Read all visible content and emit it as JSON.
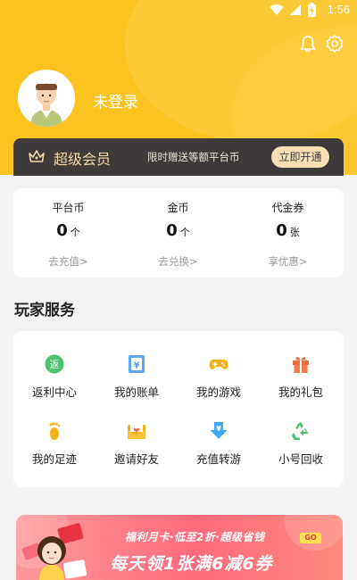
{
  "status_bar": {
    "time": "1:56"
  },
  "header": {
    "login_text": "未登录"
  },
  "vip": {
    "title": "超级会员",
    "promo": "限时赠送等额平台币",
    "button": "立即开通"
  },
  "wallet": [
    {
      "label": "平台币",
      "value": "0",
      "unit": "个",
      "link": "去充值>"
    },
    {
      "label": "金币",
      "value": "0",
      "unit": "个",
      "link": "去兑换>"
    },
    {
      "label": "代金券",
      "value": "0",
      "unit": "张",
      "link": "享优惠>"
    }
  ],
  "services": {
    "title": "玩家服务",
    "items": [
      {
        "label": "返利中心",
        "icon": "rebate-icon",
        "glyph": "返"
      },
      {
        "label": "我的账单",
        "icon": "bill-icon",
        "glyph": "¥"
      },
      {
        "label": "我的游戏",
        "icon": "gamepad-icon"
      },
      {
        "label": "我的礼包",
        "icon": "gift-icon"
      },
      {
        "label": "我的足迹",
        "icon": "footprint-icon"
      },
      {
        "label": "邀请好友",
        "icon": "invite-envelope-icon"
      },
      {
        "label": "充值转游",
        "icon": "transfer-icon",
        "glyph": "¥"
      },
      {
        "label": "小号回收",
        "icon": "recycle-icon"
      }
    ]
  },
  "banner": {
    "line1": "福利月卡·低至2折·超级省钱",
    "line2": "每天领1张满6减6券",
    "go": "GO"
  },
  "colors": {
    "brand_yellow": "#fcc21f",
    "vip_dark": "#3d3a39",
    "vip_gold": "#f4d9a6"
  }
}
